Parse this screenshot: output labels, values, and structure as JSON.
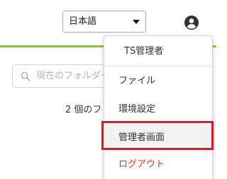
{
  "header": {
    "language_selector": {
      "value": "日本語"
    },
    "user_icon": "account-circle-icon"
  },
  "search": {
    "placeholder": "現在のフォルダー"
  },
  "content": {
    "item_count_text": "2 個のフ"
  },
  "user_menu": {
    "user_name": "TS管理者",
    "items": [
      {
        "label": "ファイル"
      },
      {
        "label": "環境設定"
      },
      {
        "label": "管理者画面",
        "highlighted": true
      },
      {
        "label": "ログアウト",
        "color": "#e03226"
      }
    ]
  },
  "colors": {
    "accent": "#8cc152",
    "highlight_outline": "#e8141e",
    "logout": "#e03226"
  }
}
